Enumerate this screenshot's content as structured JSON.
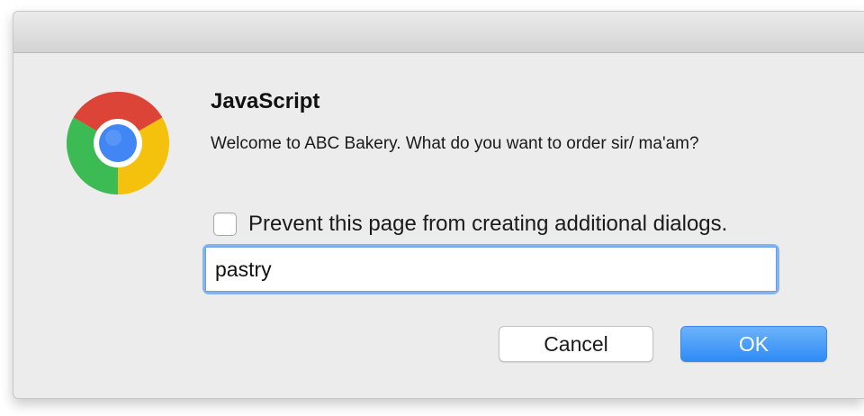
{
  "dialog": {
    "title": "JavaScript",
    "message": "Welcome to ABC Bakery. What do you want to order sir/ ma'am?",
    "icon": "chrome-logo-icon",
    "prevent_checkbox": {
      "checked": false,
      "label": "Prevent this page from creating additional dialogs."
    },
    "input": {
      "value": "pastry",
      "placeholder": ""
    },
    "buttons": {
      "cancel_label": "Cancel",
      "ok_label": "OK"
    }
  },
  "colors": {
    "dialog_background": "#ececec",
    "ok_button": "#3d94f6",
    "focus_ring": "#86b2ee",
    "chrome_red": "#db4437",
    "chrome_yellow": "#f4c20d",
    "chrome_green": "#3cba54",
    "chrome_blue": "#4285f4"
  }
}
